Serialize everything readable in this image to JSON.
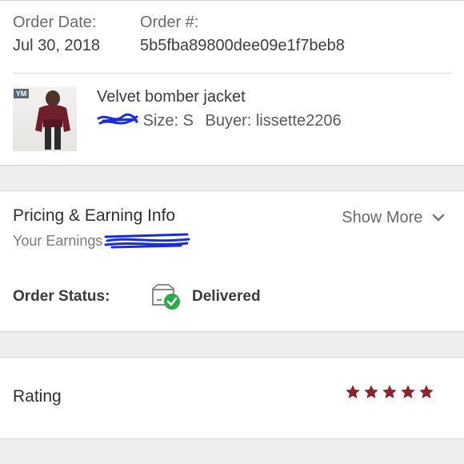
{
  "order": {
    "date_label": "Order Date:",
    "date_value": "Jul 30, 2018",
    "number_label": "Order #:",
    "number_value": "5b5fba89800dee09e1f7beb8"
  },
  "item": {
    "title": "Velvet bomber jacket",
    "size": "Size: S",
    "buyer": "Buyer: lissette2206",
    "thumbnail_logo": "YM"
  },
  "pricing": {
    "title": "Pricing & Earning Info",
    "earnings_label": "Your Earnings",
    "show_more": "Show More"
  },
  "status": {
    "label": "Order Status:",
    "value": "Delivered"
  },
  "rating": {
    "label": "Rating",
    "stars": 5
  },
  "colors": {
    "star": "#8b2332",
    "delivered_check": "#2ea84a",
    "redaction_scribble": "#1a2fd0",
    "background": "#efeeec"
  }
}
